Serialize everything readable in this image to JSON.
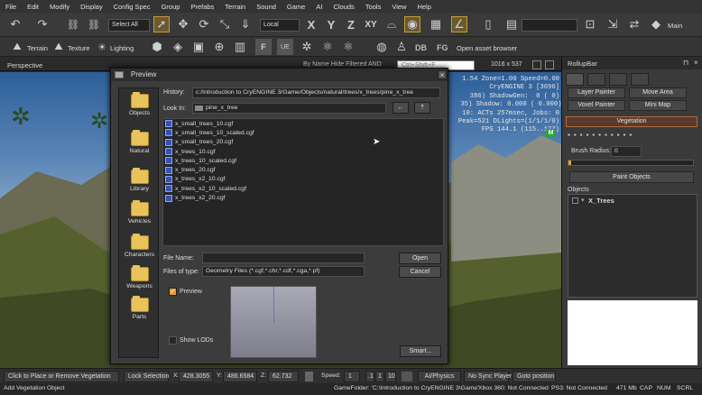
{
  "menu": [
    "File",
    "Edit",
    "Modify",
    "Display",
    "Config Spec",
    "Group",
    "Prefabs",
    "Terrain",
    "Sound",
    "Game",
    "AI",
    "Clouds",
    "Tools",
    "View",
    "Help"
  ],
  "toolbar": {
    "select_all": "Select All",
    "coord_system": "Local",
    "axis_x": "X",
    "axis_y": "Y",
    "axis_z": "Z",
    "axis_xy": "XY",
    "main_label": "Main",
    "terrain": "Terrain",
    "texture": "Texture",
    "lighting": "Lighting",
    "db": "DB",
    "fg": "FG",
    "open_asset_browser": "Open asset browser"
  },
  "viewport": {
    "title": "Perspective",
    "filter": "By Name  Hide Filtered  AND",
    "search_placeholder": "Ctrl+Shift+F",
    "resolution": "1016 x 537",
    "stats": "1.54 Zone=1.00 Speed=0.00\nCryENGINE 3 [3696]\n 386) ShadowGen:  0 ( 0)\n 35) Shadow: 0.000 ( 0.000)\n10: ACTs 257msec, Jobs: 0\nPeak=521 DLights=(1/1/1/0)\nFPS 144.1 (115..177)",
    "m_badge": "M"
  },
  "dialog": {
    "title": "Preview",
    "places": [
      "Objects",
      "Natural",
      "Library",
      "Vehicles",
      "Characters",
      "Weapons",
      "Parts"
    ],
    "history_label": "History:",
    "history_value": "c:/Introduction to CryENGINE 3/Game/Objects/natural/trees/x_trees/pine_x_tree",
    "lookin_label": "Look In:",
    "lookin_value": "pine_x_tree",
    "files": [
      "x_small_trees_10.cgf",
      "x_small_trees_10_scaled.cgf",
      "x_small_trees_20.cgf",
      "x_trees_10.cgf",
      "x_trees_10_scaled.cgf",
      "x_trees_20.cgf",
      "x_trees_x2_10.cgf",
      "x_trees_x2_10_scaled.cgf",
      "x_trees_x2_20.cgf"
    ],
    "filename_label": "File Name:",
    "filename_value": "",
    "filetype_label": "Files of type:",
    "filetype_value": "Geometry Files (*.cgf,*.chr,*.cdf,*.cga,*.pf)",
    "open": "Open",
    "cancel": "Cancel",
    "preview_label": "Preview",
    "show_lods": "Show LODs",
    "smart": "Smart..."
  },
  "rollup": {
    "title": "RollupBar",
    "terrain_buttons": [
      "Layer Painter",
      "Move Area",
      "Voxel Painter",
      "Mini Map"
    ],
    "vegetation_header": "Vegetation",
    "brush_radius_label": "Brush Radius:",
    "brush_radius_value": "0",
    "paint_objects": "Paint Objects",
    "objects_label": "Objects",
    "tree_item": "X_Trees"
  },
  "statusbar": {
    "hint": "Click to Place or Remove Vegetation",
    "lock_selection": "Lock Selection",
    "x_label": "X:",
    "x_value": "428.3055",
    "y_label": "Y:",
    "y_value": "486.6584",
    "z_label": "Z:",
    "z_value": "62.732",
    "speed_label": "Speed:",
    "speed_value": "1",
    "speed_01": ".1",
    "speed_1": "1",
    "speed_10": "10",
    "ai_physics": "AI/Physics",
    "no_sync": "No Sync Player",
    "goto": "Goto position"
  },
  "bottom": {
    "left": "Add Vegetation Object",
    "gamefolder": "GameFolder: 'C:\\Introduction to CryENGINE 3\\Game'",
    "xbox": "Xbox 360: Not Connected",
    "ps3": "PS3: Not Connected",
    "mem": "471 Mb",
    "cap": "CAP",
    "num": "NUM",
    "scrl": "SCRL"
  }
}
